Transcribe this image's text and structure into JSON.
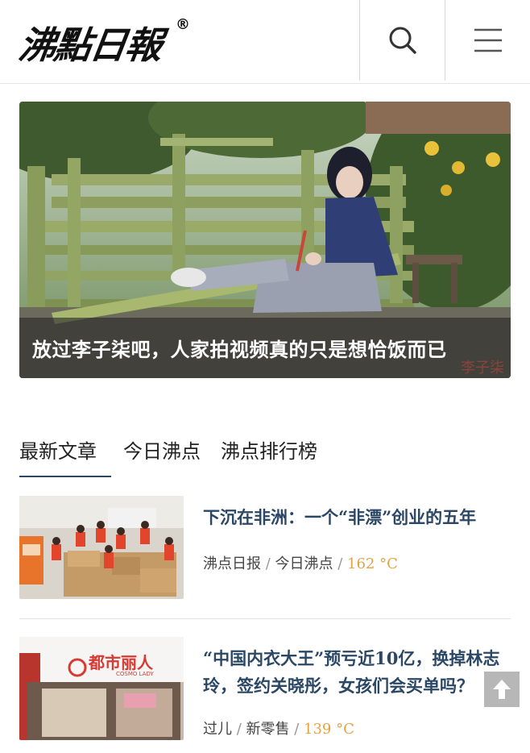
{
  "header": {
    "logo_text": "沸點日報",
    "logo_mark": "®",
    "search_icon": "search-icon",
    "menu_icon": "hamburger-menu-icon"
  },
  "hero": {
    "title": "放过李子柒吧，人家拍视频真的只是想恰饭而已",
    "watermark": "李子柒"
  },
  "tabs": [
    {
      "label": "最新文章",
      "active": true
    },
    {
      "label": "今日沸点",
      "active": false
    },
    {
      "label": "沸点排行榜",
      "active": false
    }
  ],
  "articles": [
    {
      "title": "下沉在非洲：一个“非漂”创业的五年",
      "source": "沸点日报",
      "section": "今日沸点",
      "temperature": "162 °C"
    },
    {
      "title": "“中国内衣大王”预亏近10亿，换掉林志玲，签约关晓彤，女孩们会买单吗？",
      "source": "过儿",
      "section": "新零售",
      "temperature": "139 °C",
      "store_sign": "都市丽人",
      "store_sign_sub": "COSMO LADY"
    }
  ],
  "meta_separator": " / ",
  "colors": {
    "accent": "#2b4766",
    "temperature": "#e2a340",
    "divider": "#e2e2e2"
  },
  "back_to_top_icon": "arrow-up-icon"
}
